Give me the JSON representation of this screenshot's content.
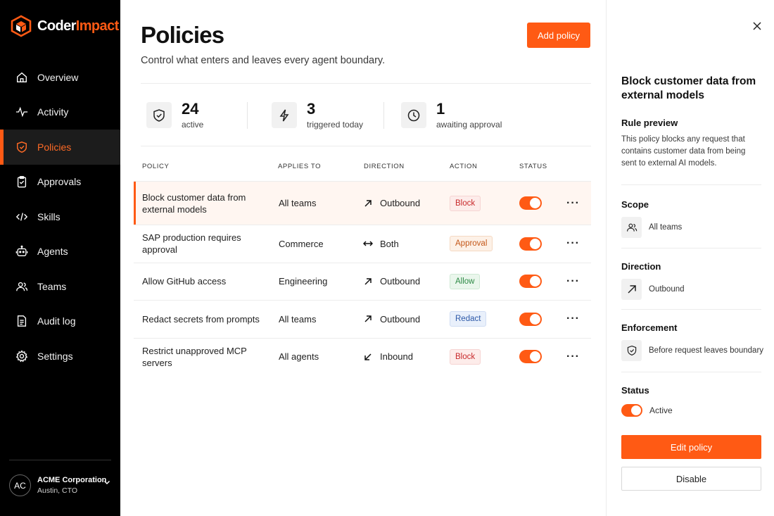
{
  "brand": {
    "name_part1": "Coder",
    "name_part2": "Impact",
    "accent": "#ff5a14"
  },
  "sidebar": {
    "items": [
      {
        "label": "Overview",
        "icon": "home-icon"
      },
      {
        "label": "Activity",
        "icon": "activity-icon"
      },
      {
        "label": "Policies",
        "icon": "shield-icon",
        "active": true
      },
      {
        "label": "Approvals",
        "icon": "clipboard-icon"
      },
      {
        "label": "Skills",
        "icon": "code-icon"
      },
      {
        "label": "Agents",
        "icon": "robot-icon"
      },
      {
        "label": "Teams",
        "icon": "users-icon"
      },
      {
        "label": "Audit log",
        "icon": "document-icon"
      },
      {
        "label": "Settings",
        "icon": "gear-icon"
      }
    ],
    "org": {
      "initials": "AC",
      "name": "ACME Corporation",
      "sub": "Austin, CTO"
    }
  },
  "main": {
    "title": "Policies",
    "subtitle": "Control what enters and leaves every agent boundary.",
    "add_button": "Add policy",
    "stats": [
      {
        "value": "24",
        "label": "active",
        "icon": "shield-check-icon"
      },
      {
        "value": "3",
        "label": "triggered today",
        "icon": "lightning-icon"
      },
      {
        "value": "1",
        "label": "awaiting approval",
        "icon": "clock-icon"
      }
    ],
    "columns": [
      "POLICY",
      "APPLIES TO",
      "DIRECTION",
      "ACTION",
      "STATUS"
    ],
    "rows": [
      {
        "name": "Block customer data from external models",
        "applies": "All teams",
        "direction": "Outbound",
        "direction_icon": "arrow-up-right-icon",
        "action": "Block",
        "action_kind": "block",
        "enabled": true
      },
      {
        "name": "SAP production requires approval",
        "applies": "Commerce",
        "direction": "Both",
        "direction_icon": "arrow-both-icon",
        "action": "Approval",
        "action_kind": "approval",
        "enabled": true
      },
      {
        "name": "Allow GitHub access",
        "applies": "Engineering",
        "direction": "Outbound",
        "direction_icon": "arrow-up-right-icon",
        "action": "Allow",
        "action_kind": "allow",
        "enabled": true
      },
      {
        "name": "Redact secrets from prompts",
        "applies": "All teams",
        "direction": "Outbound",
        "direction_icon": "arrow-up-right-icon",
        "action": "Redact",
        "action_kind": "redact",
        "enabled": true
      },
      {
        "name": "Restrict unapproved MCP servers",
        "applies": "All agents",
        "direction": "Inbound",
        "direction_icon": "arrow-down-left-icon",
        "action": "Block",
        "action_kind": "block",
        "enabled": true
      }
    ]
  },
  "panel": {
    "title": "Block customer data from external models",
    "preview_heading": "Rule preview",
    "preview_text": "This policy blocks any request that contains customer data from being sent to external AI models.",
    "scope_heading": "Scope",
    "scope_value": "All teams",
    "direction_heading": "Direction",
    "direction_value": "Outbound",
    "enforcement_heading": "Enforcement",
    "enforcement_value": "Before request leaves boundary",
    "status_heading": "Status",
    "status_value": "Active",
    "edit_button": "Edit policy",
    "disable_button": "Disable"
  }
}
